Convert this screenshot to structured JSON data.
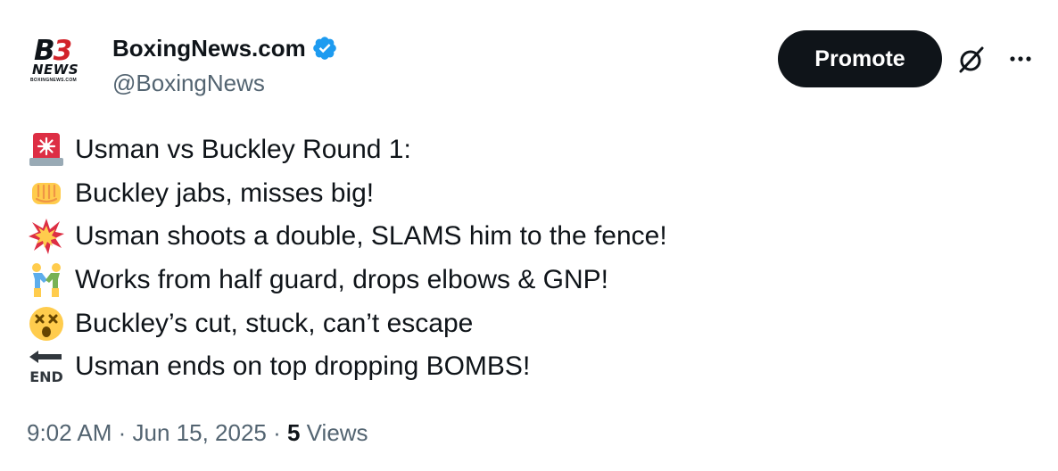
{
  "account": {
    "logo_text_b": "B",
    "logo_text_3": "3",
    "logo_text_news": "NEWS",
    "logo_text_url": "BOXINGNEWS.COM",
    "display_name": "BoxingNews.com",
    "handle": "@BoxingNews",
    "verified": true
  },
  "actions": {
    "promote_label": "Promote",
    "grok_icon": "grok-icon",
    "more_icon": "more-icon"
  },
  "post": {
    "lines": [
      {
        "emoji": "rotating-light",
        "text": "Usman vs Buckley Round 1:"
      },
      {
        "emoji": "oncoming-fist",
        "text": "Buckley jabs, misses big!"
      },
      {
        "emoji": "collision",
        "text": "Usman shoots a double, SLAMS him to the fence!"
      },
      {
        "emoji": "wrestlers",
        "text": "Works from half guard, drops elbows & GNP!"
      },
      {
        "emoji": "dizzy-face",
        "text": "Buckley’s cut, stuck, can’t escape"
      },
      {
        "emoji": "end-arrow",
        "text": "Usman ends on top dropping BOMBS!"
      }
    ]
  },
  "meta": {
    "time": "9:02 AM",
    "separator": " · ",
    "date": "Jun 15, 2025",
    "views_count": "5",
    "views_label": " Views"
  },
  "colors": {
    "primary_text": "#0f1419",
    "secondary_text": "#536471",
    "verified_blue": "#1d9bf0",
    "logo_red": "#d2232a"
  }
}
